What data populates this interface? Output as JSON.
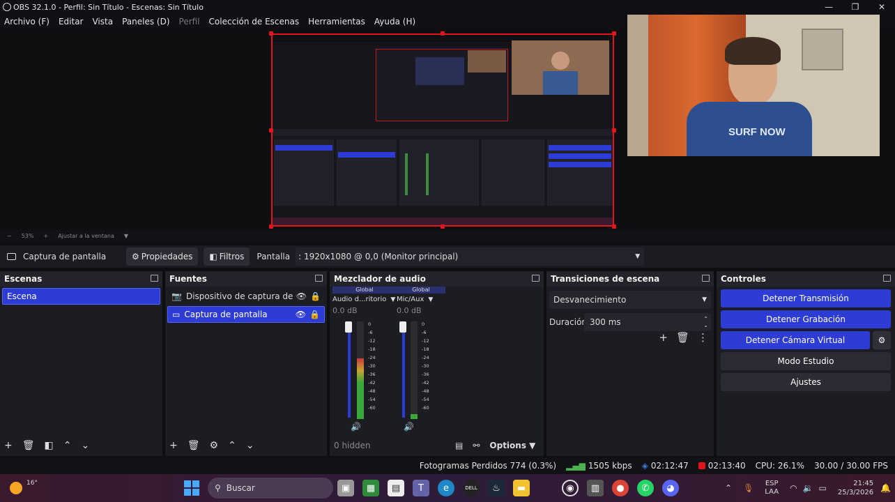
{
  "window": {
    "title": "OBS 32.1.0 - Perfil: Sin Título - Escenas: Sin Título",
    "minimize": "—",
    "maximize": "❐",
    "close": "✕"
  },
  "menu": [
    "Archivo (F)",
    "Editar",
    "Vista",
    "Paneles (D)",
    "Perfil",
    "Colección de Escenas",
    "Herramientas",
    "Ayuda (H)"
  ],
  "zoom": {
    "minus": "−",
    "value": "53%",
    "plus": "+",
    "fit": "Ajustar a la ventana"
  },
  "source_bar": {
    "source_name": "Captura de pantalla",
    "properties": "Propiedades",
    "filters": "Filtros",
    "display_label": "Pantalla",
    "display_value": ": 1920x1080 @ 0,0 (Monitor principal)"
  },
  "scenes": {
    "title": "Escenas",
    "items": [
      "Escena"
    ]
  },
  "sources": {
    "title": "Fuentes",
    "items": [
      "Dispositivo de captura de video",
      "Captura de pantalla"
    ]
  },
  "mixer": {
    "title": "Mezclador de audio",
    "channels": [
      {
        "global": "Global",
        "name": "Audio d...ritorio",
        "db": "0.0 dB",
        "level": 0.62
      },
      {
        "global": "Global",
        "name": "Mic/Aux",
        "db": "0.0 dB",
        "level": 0.05
      }
    ],
    "scale": [
      "0",
      "-6",
      "-12",
      "-18",
      "-24",
      "-30",
      "-36",
      "-42",
      "-48",
      "-54",
      "-60"
    ],
    "hidden": "0 hidden",
    "options": "Options"
  },
  "transitions": {
    "title": "Transiciones de escena",
    "type": "Desvanecimiento",
    "duration_label": "Duración",
    "duration_value": "300 ms"
  },
  "controls": {
    "title": "Controles",
    "buttons": [
      "Detener Transmisión",
      "Detener Grabación",
      "Detener Cámara Virtual",
      "Modo Estudio",
      "Ajustes"
    ]
  },
  "status": {
    "dropped": "Fotogramas Perdidos 774 (0.3%)",
    "kbps": "1505 kbps",
    "stream_time": "02:12:47",
    "rec_time": "02:13:40",
    "cpu": "CPU: 26.1%",
    "fps": "30.00 / 30.00 FPS"
  },
  "taskbar": {
    "weather": "16°",
    "search": "Buscar",
    "lang_top": "ESP",
    "lang_bottom": "LAA",
    "time": "21:45",
    "date": "25/3/2026"
  },
  "colors": {
    "accent": "#2e3cd6",
    "selection_border": "#e0161c",
    "recording": "#e0161c"
  }
}
